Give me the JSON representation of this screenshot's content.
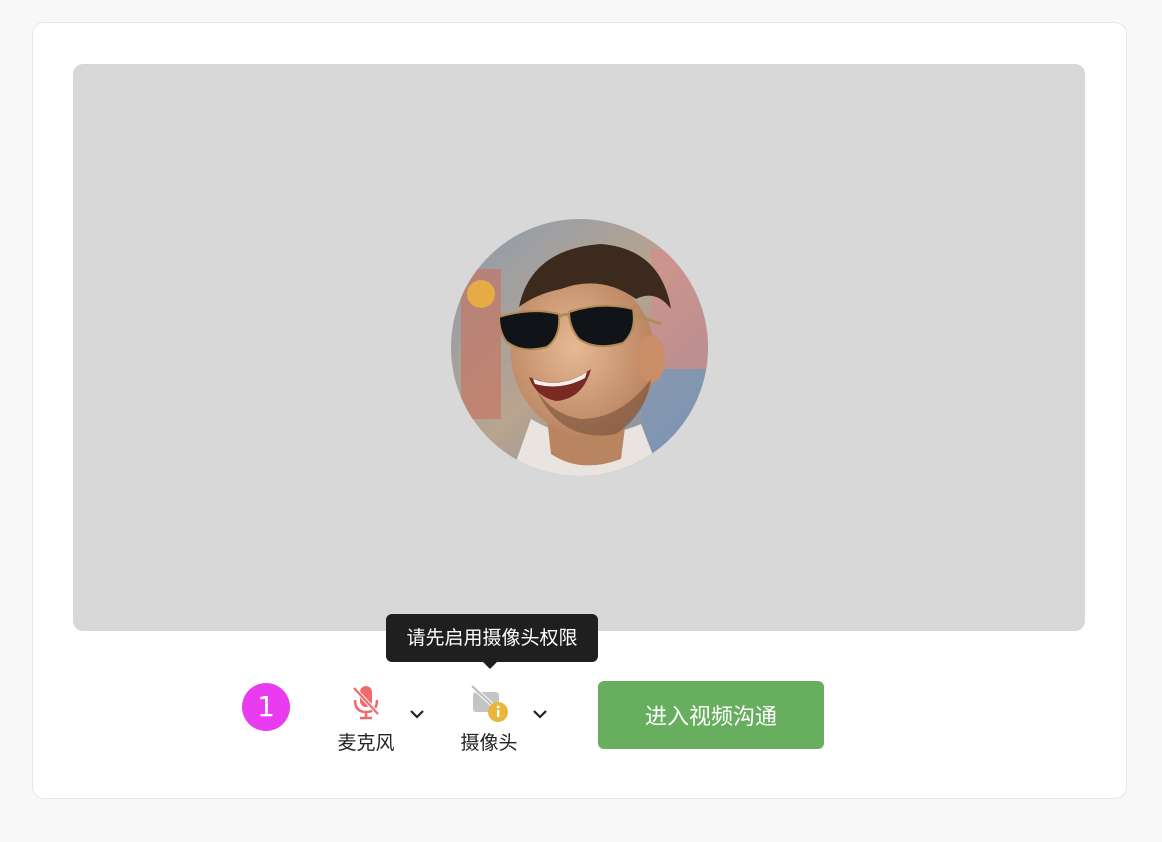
{
  "preview": {
    "avatar_alt": ""
  },
  "tooltip": {
    "text": "请先启用摄像头权限"
  },
  "step_badge": {
    "number": "1"
  },
  "controls": {
    "microphone": {
      "label": "麦克风",
      "icon": "mic-off-icon",
      "status_color": "#ee6c6c"
    },
    "camera": {
      "label": "摄像头",
      "icon": "camera-off-icon",
      "warning_color": "#e9b53b"
    },
    "enter_button": {
      "label": "进入视频沟通",
      "color": "#67ae5e"
    }
  }
}
